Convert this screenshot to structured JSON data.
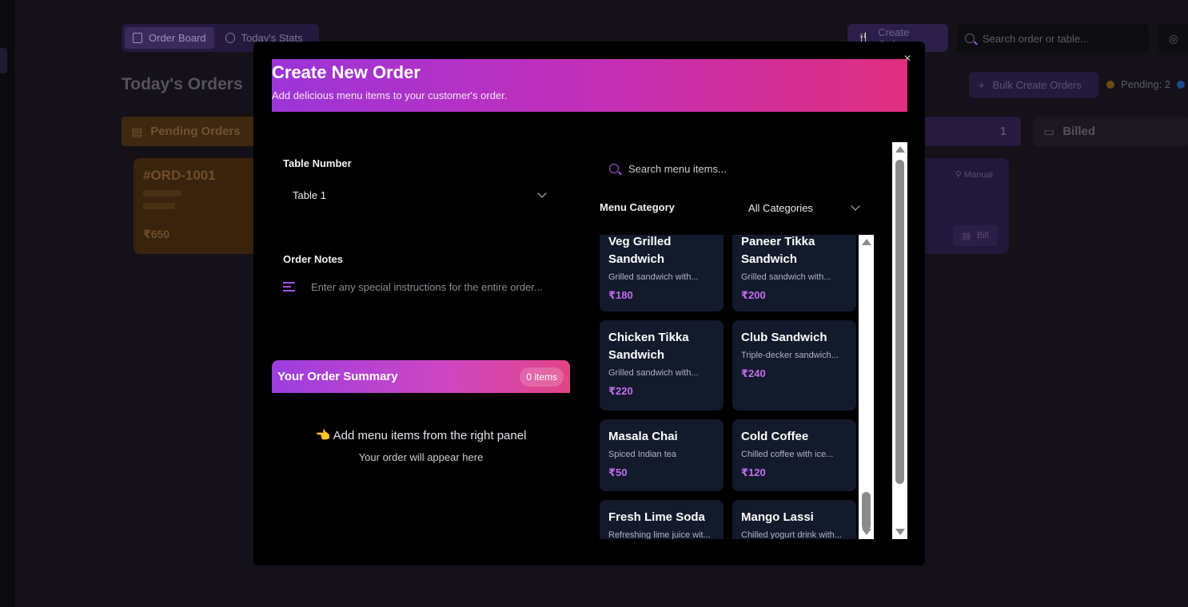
{
  "background": {
    "tabs": [
      {
        "label": "Order Board",
        "icon": "clipboard-icon"
      },
      {
        "label": "Today's Stats",
        "icon": "timer-icon"
      }
    ],
    "create_order_label": "Create Order",
    "search_placeholder": "Search order or table...",
    "page_title": "Today's Orders",
    "bulk_label": "Bulk Create Orders",
    "pending_label": "Pending: 2",
    "columns": {
      "pending": "Pending Orders",
      "progress_count": "1",
      "billed": "Billed"
    },
    "pending_card": {
      "id": "#ORD-1001",
      "amount": "₹650"
    },
    "progress_card": {
      "tag": "Manual",
      "bill_label": "Bill"
    },
    "colors": {
      "pending": "#f59e0b",
      "progress": "#3b82f6"
    }
  },
  "modal": {
    "close_symbol": "×",
    "title": "Create New Order",
    "subtitle": "Add delicious menu items to your customer's order.",
    "table_label": "Table Number",
    "table_value": "Table 1",
    "notes_label": "Order Notes",
    "notes_placeholder": "Enter any special instructions for the entire order...",
    "summary_title": "Your Order Summary",
    "summary_count": "0 items",
    "empty_title": "👈 Add menu items from the right panel",
    "empty_sub": "Your order will appear here",
    "menu_search_placeholder": "Search menu items...",
    "category_label": "Menu Category",
    "category_value": "All Categories",
    "accent": "#a64fe6",
    "items": [
      {
        "name": "Veg Grilled Sandwich",
        "desc": "Grilled sandwich with...",
        "price": "₹180"
      },
      {
        "name": "Paneer Tikka Sandwich",
        "desc": "Grilled sandwich with...",
        "price": "₹200"
      },
      {
        "name": "Chicken Tikka Sandwich",
        "desc": "Grilled sandwich with...",
        "price": "₹220"
      },
      {
        "name": "Club Sandwich",
        "desc": "Triple-decker sandwich...",
        "price": "₹240"
      },
      {
        "name": "Masala Chai",
        "desc": "Spiced Indian tea",
        "price": "₹50"
      },
      {
        "name": "Cold Coffee",
        "desc": "Chilled coffee with ice...",
        "price": "₹120"
      },
      {
        "name": "Fresh Lime Soda",
        "desc": "Refreshing lime juice wit...",
        "price": ""
      },
      {
        "name": "Mango Lassi",
        "desc": "Chilled yogurt drink with...",
        "price": ""
      }
    ]
  }
}
